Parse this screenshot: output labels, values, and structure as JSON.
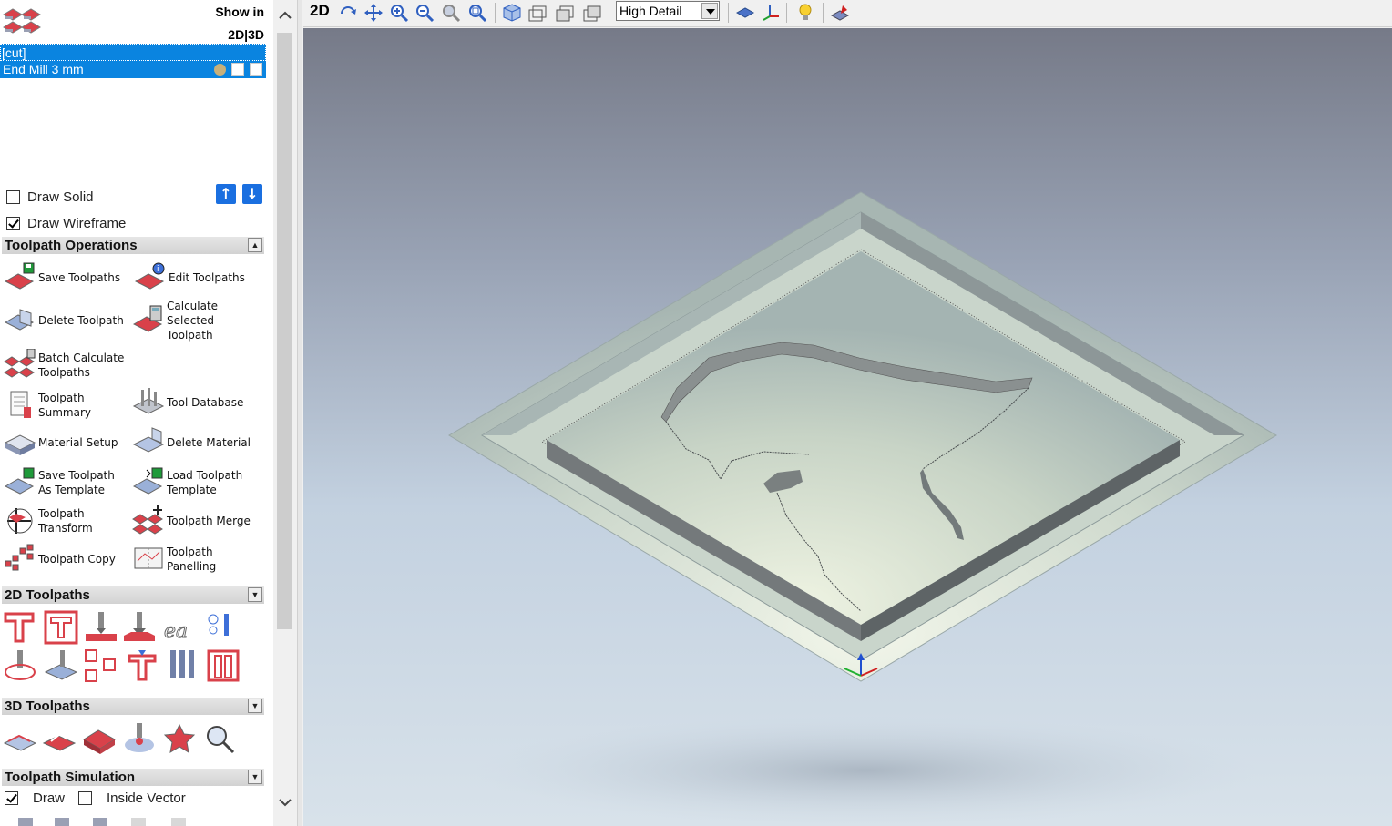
{
  "toolpaths_panel": {
    "show_in_label": "Show in",
    "show_in_modes": "2D|3D",
    "group_name": "[cut]",
    "toolpath_name": "End Mill 3 mm",
    "draw_solid": {
      "label": "Draw Solid",
      "checked": false
    },
    "draw_wireframe": {
      "label": "Draw Wireframe",
      "checked": true
    }
  },
  "sections": {
    "operations": {
      "title": "Toolpath Operations"
    },
    "toolpaths_2d": {
      "title": "2D Toolpaths"
    },
    "toolpaths_3d": {
      "title": "3D Toolpaths"
    },
    "simulation": {
      "title": "Toolpath Simulation"
    }
  },
  "operations": [
    {
      "label": "Save Toolpaths",
      "icon": "save-toolpaths-icon"
    },
    {
      "label": "Edit Toolpaths",
      "icon": "edit-toolpaths-icon"
    },
    {
      "label": "Delete Toolpath",
      "icon": "delete-toolpath-icon"
    },
    {
      "label": "Calculate\nSelected\nToolpath",
      "icon": "calculate-toolpath-icon"
    },
    {
      "label": "Batch Calculate\nToolpaths",
      "icon": "batch-calculate-icon"
    },
    {
      "label": "Toolpath\nSummary",
      "icon": "toolpath-summary-icon"
    },
    {
      "label": "Tool Database",
      "icon": "tool-database-icon"
    },
    {
      "label": "Material Setup",
      "icon": "material-setup-icon"
    },
    {
      "label": "Delete Material",
      "icon": "delete-material-icon"
    },
    {
      "label": "Save Toolpath\nAs Template",
      "icon": "save-template-icon"
    },
    {
      "label": "Load Toolpath\nTemplate",
      "icon": "load-template-icon"
    },
    {
      "label": "Toolpath\nTransform",
      "icon": "toolpath-transform-icon"
    },
    {
      "label": "Toolpath Merge",
      "icon": "toolpath-merge-icon"
    },
    {
      "label": "Toolpath Copy",
      "icon": "toolpath-copy-icon"
    },
    {
      "label": "Toolpath\nPanelling",
      "icon": "toolpath-panelling-icon"
    }
  ],
  "simulation": {
    "draw": {
      "label": "Draw",
      "checked": true
    },
    "inside_vector": {
      "label": "Inside Vector",
      "checked": false
    }
  },
  "toolbar": {
    "view_2d_label": "2D",
    "detail_level": "High Detail"
  },
  "colors": {
    "selection": "#0a84e0",
    "section_header": "#d9d9d9",
    "material_top": "#c4d2c2",
    "material_side": "#6f7578"
  }
}
